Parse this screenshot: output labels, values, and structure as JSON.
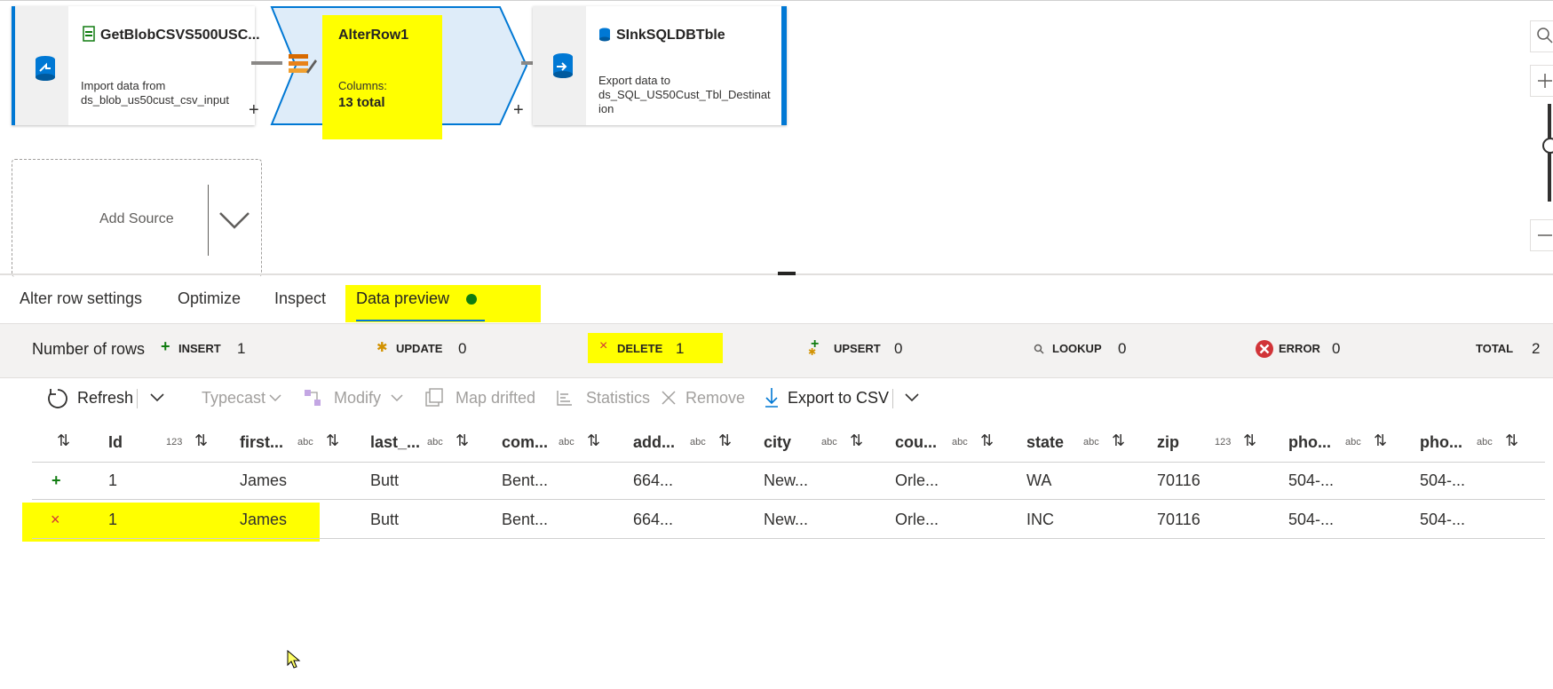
{
  "pipeline": {
    "source": {
      "title": "GetBlobCSVS500USC...",
      "desc1": "Import data from",
      "desc2": "ds_blob_us50cust_csv_input"
    },
    "alterrow": {
      "title": "AlterRow1",
      "columns_label": "Columns:",
      "columns_value": "13 total"
    },
    "sink": {
      "title": "SInkSQLDBTble",
      "desc1": "Export data to",
      "desc2": "ds_SQL_US50Cust_Tbl_Destinat",
      "desc3": "ion"
    },
    "plus": "+",
    "add_source": "Add Source"
  },
  "tabs": [
    {
      "label": "Alter row settings"
    },
    {
      "label": "Optimize"
    },
    {
      "label": "Inspect"
    },
    {
      "label": "Data preview"
    }
  ],
  "row_stats": {
    "label": "Number of rows",
    "insert_label": "INSERT",
    "insert_value": "1",
    "update_label": "UPDATE",
    "update_value": "0",
    "delete_label": "DELETE",
    "delete_value": "1",
    "upsert_label": "UPSERT",
    "upsert_value": "0",
    "lookup_label": "LOOKUP",
    "lookup_value": "0",
    "error_label": "ERROR",
    "error_value": "0",
    "total_label": "TOTAL",
    "total_value": "2"
  },
  "toolbar": {
    "refresh": "Refresh",
    "typecast": "Typecast",
    "modify": "Modify",
    "map_drifted": "Map drifted",
    "statistics": "Statistics",
    "remove": "Remove",
    "export": "Export to CSV"
  },
  "columns": [
    {
      "name": "Id",
      "type": "123"
    },
    {
      "name": "first...",
      "type": "abc"
    },
    {
      "name": "last_...",
      "type": "abc"
    },
    {
      "name": "com...",
      "type": "abc"
    },
    {
      "name": "add...",
      "type": "abc"
    },
    {
      "name": "city",
      "type": "abc"
    },
    {
      "name": "cou...",
      "type": "abc"
    },
    {
      "name": "state",
      "type": "abc"
    },
    {
      "name": "zip",
      "type": "123"
    },
    {
      "name": "pho...",
      "type": "abc"
    },
    {
      "name": "pho...",
      "type": "abc"
    }
  ],
  "rows": [
    {
      "marker": "+",
      "cells": [
        "1",
        "James",
        "Butt",
        "Bent...",
        "664...",
        "New...",
        "Orle...",
        "WA",
        "70116",
        "504-...",
        "504-..."
      ]
    },
    {
      "marker": "×",
      "cells": [
        "1",
        "James",
        "Butt",
        "Bent...",
        "664...",
        "New...",
        "Orle...",
        "INC",
        "70116",
        "504-...",
        "504-..."
      ]
    }
  ],
  "colors": {
    "accent": "#0078d4",
    "highlight": "#ffff00",
    "insert": "#107c10",
    "delete": "#d13438",
    "update": "#d29200",
    "status_ok": "#107c10"
  }
}
